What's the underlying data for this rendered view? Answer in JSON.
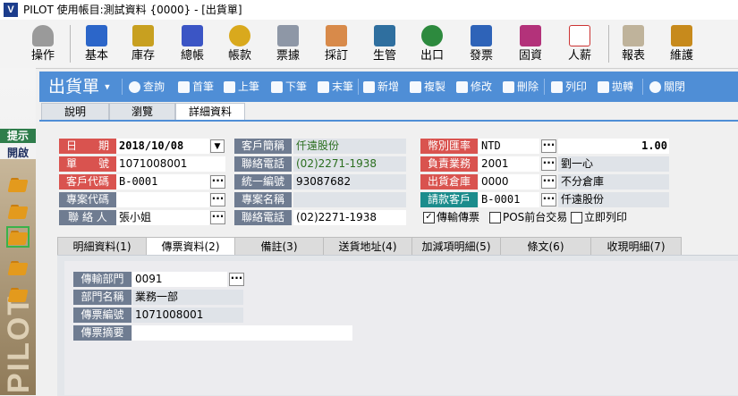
{
  "window": {
    "title": "PILOT  使用帳目:測試資料 {0000} - [出貨單]",
    "logo": "V"
  },
  "main_toolbar": [
    {
      "label": "操作",
      "icon": "mouse-icon",
      "color": "#8a8a8a"
    },
    {
      "label": "基本",
      "icon": "grid-icon",
      "color": "#2c66c9"
    },
    {
      "label": "庫存",
      "icon": "bag-icon",
      "color": "#c8a020"
    },
    {
      "label": "總帳",
      "icon": "ledger-icon",
      "color": "#3b55c5"
    },
    {
      "label": "帳款",
      "icon": "coins-icon",
      "color": "#d9a91d"
    },
    {
      "label": "票據",
      "icon": "note-icon",
      "color": "#7f8a9a"
    },
    {
      "label": "採訂",
      "icon": "handshake-icon",
      "color": "#d88a4a"
    },
    {
      "label": "生管",
      "icon": "gear-icon",
      "color": "#2f6f9f"
    },
    {
      "label": "出口",
      "icon": "globe-icon",
      "color": "#2d8a3e"
    },
    {
      "label": "發票",
      "icon": "floppy-icon",
      "color": "#2e63b8"
    },
    {
      "label": "固資",
      "icon": "stairs-icon",
      "color": "#b3327a"
    },
    {
      "label": "人薪",
      "icon": "chart-icon",
      "color": "#c33"
    },
    {
      "label": "報表",
      "icon": "report-icon",
      "color": "#7a6a50"
    },
    {
      "label": "維護",
      "icon": "tools-icon",
      "color": "#c78a1c"
    }
  ],
  "left_panel": {
    "hint": "提示",
    "open": "開啟",
    "brand": "PILOT"
  },
  "command_bar": {
    "doc_name": "出貨單",
    "buttons": [
      {
        "label": "查詢",
        "icon": "search-icon"
      },
      {
        "label": "首筆",
        "icon": "first-record-icon"
      },
      {
        "label": "上筆",
        "icon": "prev-record-icon"
      },
      {
        "label": "下筆",
        "icon": "next-record-icon"
      },
      {
        "label": "末筆",
        "icon": "last-record-icon"
      },
      {
        "label": "新增",
        "icon": "new-icon"
      },
      {
        "label": "複製",
        "icon": "copy-icon"
      },
      {
        "label": "修改",
        "icon": "edit-icon"
      },
      {
        "label": "刪除",
        "icon": "delete-icon"
      },
      {
        "label": "列印",
        "icon": "print-icon"
      },
      {
        "label": "拋轉",
        "icon": "transfer-icon"
      },
      {
        "label": "關閉",
        "icon": "close-icon"
      }
    ]
  },
  "top_tabs": [
    "說明",
    "瀏覽",
    "詳細資料"
  ],
  "header_form": {
    "date_label": "日　　期",
    "date_value": "2018/10/08",
    "order_no_label": "單　　號",
    "order_no_value": "1071008001",
    "customer_code_label": "客戶代碼",
    "customer_code_value": "B-0001",
    "project_code_label": "專案代碼",
    "project_code_value": "",
    "contact_label": "聯 絡 人",
    "contact_value": "張小姐",
    "customer_short_label": "客戶簡稱",
    "customer_short_value": "仟遠股份",
    "phone1_label": "聯絡電話",
    "phone1_value": "(02)2271-1938",
    "tax_id_label": "統一編號",
    "tax_id_value": "93087682",
    "project_name_label": "專案名稱",
    "project_name_value": "",
    "phone2_label": "聯絡電話",
    "phone2_value": "(02)2271-1938",
    "currency_label": "幣別匯率",
    "currency_value": "NTD",
    "rate_value": "1.00",
    "staff_label": "負責業務",
    "staff_code": "2001",
    "staff_name": "劉一心",
    "warehouse_label": "出貨倉庫",
    "warehouse_code": "0000",
    "warehouse_name": "不分倉庫",
    "bill_customer_label": "請款客戶",
    "bill_customer_code": "B-0001",
    "bill_customer_name": "仟遠股份",
    "chk_transfer": "傳輸傳票",
    "chk_transfer_mark": "✓",
    "chk_pos": "POS前台交易",
    "chk_print": "立即列印"
  },
  "sub_tabs": [
    "明細資料(1)",
    "傳票資料(2)",
    "備註(3)",
    "送貨地址(4)",
    "加減項明細(5)",
    "條文(6)",
    "收現明細(7)"
  ],
  "voucher_form": {
    "dept_label": "傳輸部門",
    "dept_value": "0091",
    "dept_name_label": "部門名稱",
    "dept_name_value": "業務一部",
    "voucher_no_label": "傳票編號",
    "voucher_no_value": "1071008001",
    "summary_label": "傳票摘要",
    "summary_value": ""
  },
  "ui": {
    "dots": "···",
    "drop": "▼",
    "caret": "▾"
  }
}
